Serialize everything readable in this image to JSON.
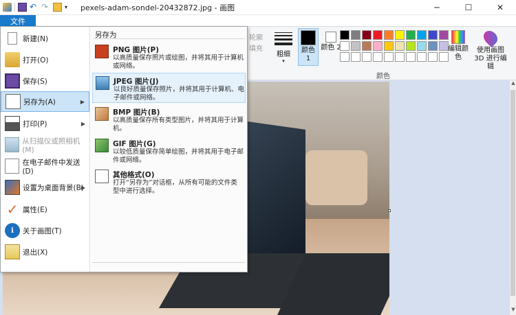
{
  "window": {
    "title": "pexels-adam-sondel-20432872.jpg - 画图",
    "minimize": "─",
    "maximize": "☐",
    "close": "✕"
  },
  "ribbon": {
    "file_tab": "文件",
    "ghost_labels": [
      "轮廓",
      "填充"
    ],
    "line_width": "粗细",
    "color1": "颜色 1",
    "color2": "颜色 2",
    "colors_group": "颜色",
    "edit_colors": "编辑颜色",
    "paint3d": "使用画图 3D 进行编辑",
    "palette": [
      "#000000",
      "#7f7f7f",
      "#880015",
      "#ed1c24",
      "#ff7f27",
      "#fff200",
      "#22b14c",
      "#00a2e8",
      "#3f48cc",
      "#a349a4",
      "#ffffff",
      "#c3c3c3",
      "#b97a57",
      "#ffaec9",
      "#ffc90e",
      "#efe4b0",
      "#b5e61d",
      "#99d9ea",
      "#7092be",
      "#c8bfe7",
      "#ffffff",
      "#ffffff",
      "#ffffff",
      "#ffffff",
      "#ffffff",
      "#ffffff",
      "#ffffff",
      "#ffffff",
      "#ffffff",
      "#ffffff"
    ]
  },
  "file_menu": {
    "items": [
      {
        "label": "新建(N)",
        "icon": "new-file-icon",
        "arrow": false,
        "disabled": false
      },
      {
        "label": "打开(O)",
        "icon": "open-folder-icon",
        "arrow": false,
        "disabled": false
      },
      {
        "label": "保存(S)",
        "icon": "save-disk-icon",
        "arrow": false,
        "disabled": false
      },
      {
        "label": "另存为(A)",
        "icon": "save-as-icon",
        "arrow": true,
        "disabled": false,
        "active": true
      },
      {
        "label": "打印(P)",
        "icon": "printer-icon",
        "arrow": true,
        "disabled": false
      },
      {
        "label": "从扫描仪或照相机(M)",
        "icon": "scanner-icon",
        "arrow": false,
        "disabled": true
      },
      {
        "label": "在电子邮件中发送(D)",
        "icon": "email-icon",
        "arrow": false,
        "disabled": false
      },
      {
        "label": "设置为桌面背景(B)",
        "icon": "desktop-background-icon",
        "arrow": true,
        "disabled": false
      },
      {
        "label": "属性(E)",
        "icon": "properties-check-icon",
        "arrow": false,
        "disabled": false
      },
      {
        "label": "关于画图(T)",
        "icon": "about-info-icon",
        "arrow": false,
        "disabled": false
      },
      {
        "label": "退出(X)",
        "icon": "exit-icon",
        "arrow": false,
        "disabled": false
      }
    ],
    "submenu_title": "另存为",
    "submenu": [
      {
        "title": "PNG 图片(P)",
        "desc": "以高质量保存照片或绘图，并将其用于计算机或网络。",
        "icon": "png-image-icon"
      },
      {
        "title": "JPEG 图片(J)",
        "desc": "以良好质量保存照片，并将其用于计算机、电子邮件或网络。",
        "icon": "jpeg-image-icon",
        "active": true
      },
      {
        "title": "BMP 图片(B)",
        "desc": "以高质量保存所有类型图片，并将其用于计算机。",
        "icon": "bmp-image-icon"
      },
      {
        "title": "GIF 图片(G)",
        "desc": "以较低质量保存简单绘图，并将其用于电子邮件或网络。",
        "icon": "gif-image-icon"
      },
      {
        "title": "其他格式(O)",
        "desc": "打开“另存为”对话框，从所有可能的文件类型中进行选择。",
        "icon": "other-formats-icon"
      }
    ]
  }
}
